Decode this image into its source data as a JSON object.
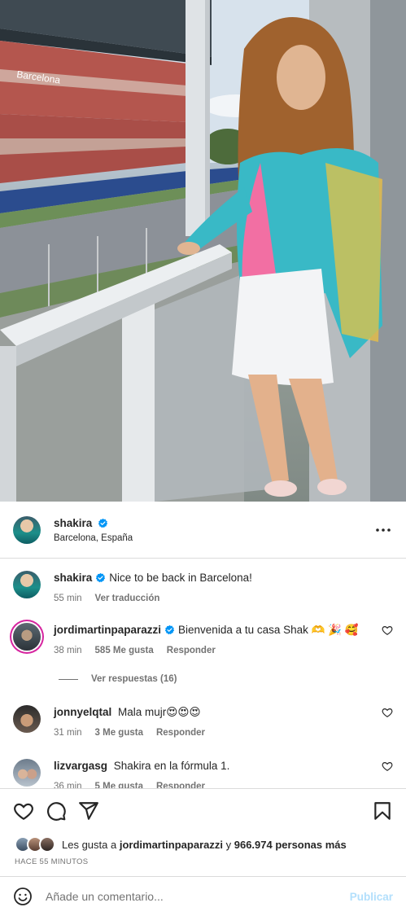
{
  "post": {
    "author": "shakira",
    "location": "Barcelona, España",
    "more_icon": "more-horizontal-icon"
  },
  "photo": {
    "description_icon": "post-photo",
    "stand_sign": "Barcelona"
  },
  "caption": {
    "username": "shakira",
    "text": "Nice to be back in Barcelona!",
    "time": "55 min",
    "translate": "Ver traducción"
  },
  "comments": [
    {
      "username": "jordimartinpaparazzi",
      "text": "Bienvenida a tu casa Shak 🫶 🎉 🥰",
      "time": "38 min",
      "likes": "585 Me gusta",
      "reply": "Responder",
      "view_replies": "Ver respuestas (16)"
    },
    {
      "username": "jonnyelqtal",
      "text": "Mala mujr😍😍😍",
      "time": "31 min",
      "likes": "3 Me gusta",
      "reply": "Responder"
    },
    {
      "username": "lizvargasg",
      "text": "Shakira en la fórmula 1.",
      "time": "36 min",
      "likes": "5 Me gusta",
      "reply": "Responder"
    }
  ],
  "likes": {
    "prefix": "Les gusta a",
    "user": "jordimartinpaparazzi",
    "middle": "y",
    "others": "966.974 personas más"
  },
  "timestamp": "HACE 55 MINUTOS",
  "add_comment": {
    "placeholder": "Añade un comentario...",
    "publish": "Publicar"
  },
  "colors": {
    "verified": "#0095f6",
    "publish_disabled": "#b2dffc",
    "secondary_text": "#737373"
  }
}
